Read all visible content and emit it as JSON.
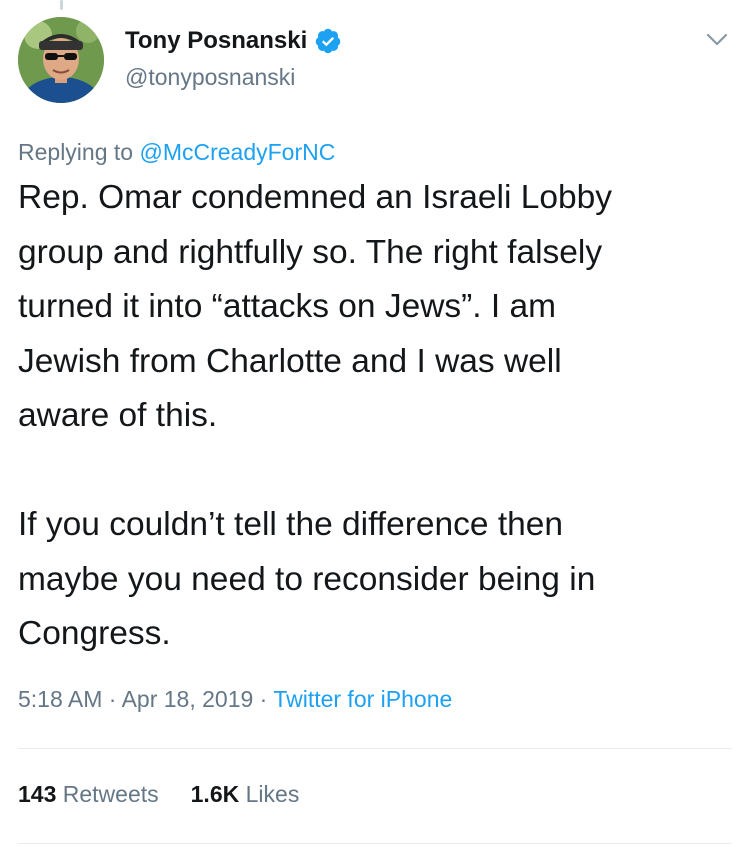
{
  "author": {
    "display_name": "Tony Posnanski",
    "handle": "@tonyposnanski",
    "verified": true,
    "avatar_icon": "profile-photo-avatar"
  },
  "reply": {
    "prefix": "Replying to ",
    "mention": "@McCreadyForNC"
  },
  "tweet": {
    "text": "Rep. Omar condemned an Israeli Lobby\ngroup and rightfully so. The right falsely\nturned it into “attacks on Jews”. I am\nJewish from Charlotte and I was well\naware of this.\n\nIf you couldn’t tell the difference then\nmaybe you need to reconsider being in\nCongress."
  },
  "meta": {
    "time": "5:18 AM",
    "separator": " · ",
    "date": "Apr 18, 2019",
    "source": "Twitter for iPhone"
  },
  "stats": {
    "retweets_count": "143",
    "retweets_label": " Retweets",
    "likes_count": "1.6K",
    "likes_label": " Likes"
  },
  "colors": {
    "link_blue": "#1da1f2",
    "secondary_text": "#657786",
    "primary_text": "#14171a",
    "divider": "#e6ecf0"
  },
  "icons": [
    "verified-badge-icon",
    "chevron-down-icon"
  ]
}
